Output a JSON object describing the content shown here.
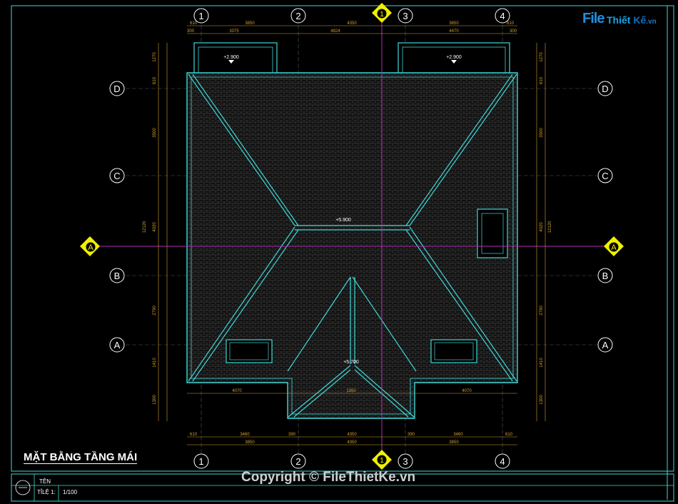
{
  "drawing": {
    "title": "MẶT BẰNG TẦNG MÁI",
    "copyright": "Copyright © FileThietKe.vn",
    "title_block": {
      "name_label": "TÊN",
      "scale_label": "TỈLỆ 1:",
      "scale_value": "1/100"
    }
  },
  "logo": {
    "file": "File",
    "thiet": "Thiết ",
    "ke": "Kế",
    "vn": ".vn"
  },
  "grid": {
    "columns": [
      "1",
      "2",
      "3",
      "4"
    ],
    "rows": [
      "D",
      "C",
      "B",
      "A"
    ]
  },
  "section": {
    "label": "A",
    "marker": "1"
  },
  "elevations": {
    "balcony_left": "+2.900",
    "balcony_right": "+2.900",
    "ridge_main": "+5.900",
    "ridge_front": "+5.700"
  },
  "dimensions": {
    "top_row1": [
      "610",
      "3850",
      "4350",
      "3850",
      "610"
    ],
    "top_row2": [
      "300",
      "3375",
      "4824",
      "4470",
      "300"
    ],
    "bottom_row1": [
      "610",
      "3460",
      "390",
      "4350",
      "390",
      "3460",
      "610"
    ],
    "bottom_row2": [
      "3850",
      "4350",
      "3850"
    ],
    "inner_bottom": [
      "4070",
      "1350",
      "4070"
    ],
    "left_vertical": [
      "1270",
      "610",
      "3500",
      "4020",
      "2790",
      "1410",
      "1300"
    ],
    "left_total": "12120",
    "right_vertical": [
      "1270",
      "610",
      "3500",
      "4020",
      "2790",
      "1410",
      "1300"
    ],
    "right_total": "12120"
  },
  "colors": {
    "background": "#000000",
    "roof_line": "#3fd8d8",
    "axis_line": "#b030b0",
    "dimension": "#d4a030",
    "grid_text": "#ffffff",
    "section_marker": "#f0f000",
    "tile_hatch": "#4a4a4a"
  }
}
